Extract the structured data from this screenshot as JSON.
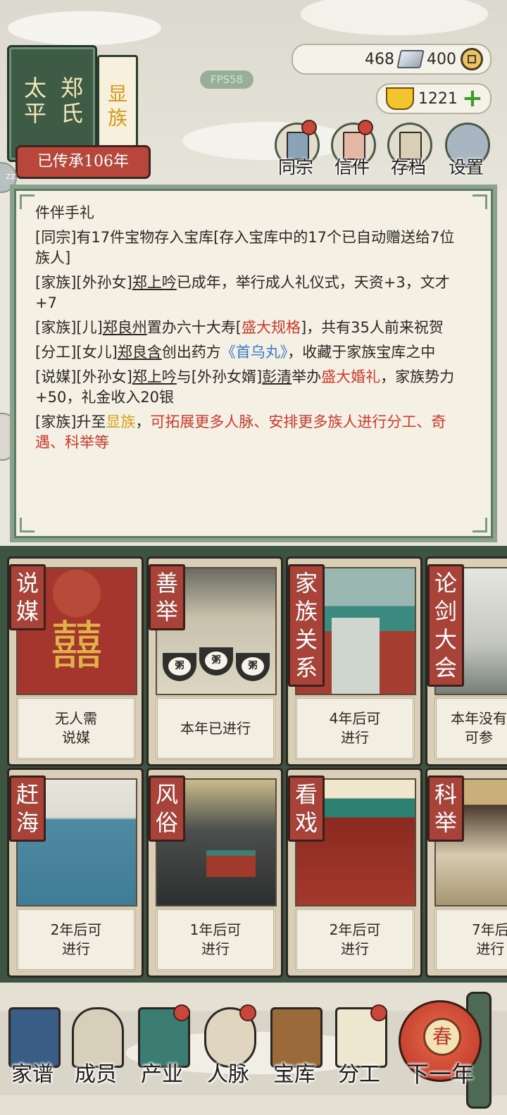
{
  "clan": {
    "motto_col1": "太平",
    "motto_col2": "郑氏",
    "rank": "显族",
    "inherit": "已传承106年"
  },
  "fps": "FPS58",
  "resources": {
    "silver": "468",
    "coins": "400",
    "gold": "1221"
  },
  "top_buttons": [
    {
      "label": "同宗",
      "icon": "clan-books-icon"
    },
    {
      "label": "信件",
      "icon": "letter-icon"
    },
    {
      "label": "存档",
      "icon": "save-scroll-icon"
    },
    {
      "label": "设置",
      "icon": "gear-icon"
    }
  ],
  "log": {
    "l0": "件伴手礼",
    "l1": "[同宗]有17件宝物存入宝库[存入宝库中的17个已自动赠送给7位族人]",
    "l2a": "[家族][外孙女]",
    "l2b": "郑上吟",
    "l2c": "已成年，举行成人礼仪式，天资+3，文才+7",
    "l3a": "[家族][儿]",
    "l3b": "郑良州",
    "l3c": "置办六十大寿[",
    "l3d": "盛大规格",
    "l3e": "]，共有35人前来祝贺",
    "l4a": "[分工][女儿]",
    "l4b": "郑良含",
    "l4c": "创出药方",
    "l4d": "《首乌丸》",
    "l4e": "，收藏于家族宝库之中",
    "l5a": "[说媒][外孙女]",
    "l5b": "郑上吟",
    "l5c": "与[外孙女婿]",
    "l5d": "彭清",
    "l5e": "举办",
    "l5f": "盛大婚礼",
    "l5g": "，家族势力+50，礼金收入20银",
    "l6a": "[家族]升至",
    "l6b": "显族",
    "l6c": "，",
    "l6d": "可拓展更多人脉、安排更多族人进行分工、奇遇、科举等"
  },
  "activities": [
    {
      "tag": "说媒",
      "status": "无人需\n说媒"
    },
    {
      "tag": "善举",
      "status": "本年已进行"
    },
    {
      "tag": "家族关系",
      "status": "4年后可\n进行"
    },
    {
      "tag": "论剑大会",
      "status": "本年没有\n可参"
    },
    {
      "tag": "赶海",
      "status": "2年后可\n进行"
    },
    {
      "tag": "风俗",
      "status": "1年后可\n进行"
    },
    {
      "tag": "看戏",
      "status": "2年后可\n进行"
    },
    {
      "tag": "科举",
      "status": "7年后\n进行"
    }
  ],
  "porridge_char": "粥",
  "xi_char": "囍",
  "nav": [
    {
      "label": "家谱"
    },
    {
      "label": "成员"
    },
    {
      "label": "产业"
    },
    {
      "label": "人脉"
    },
    {
      "label": "宝库"
    },
    {
      "label": "分工"
    }
  ],
  "next_year": {
    "lantern": "春",
    "label": "下一年"
  }
}
